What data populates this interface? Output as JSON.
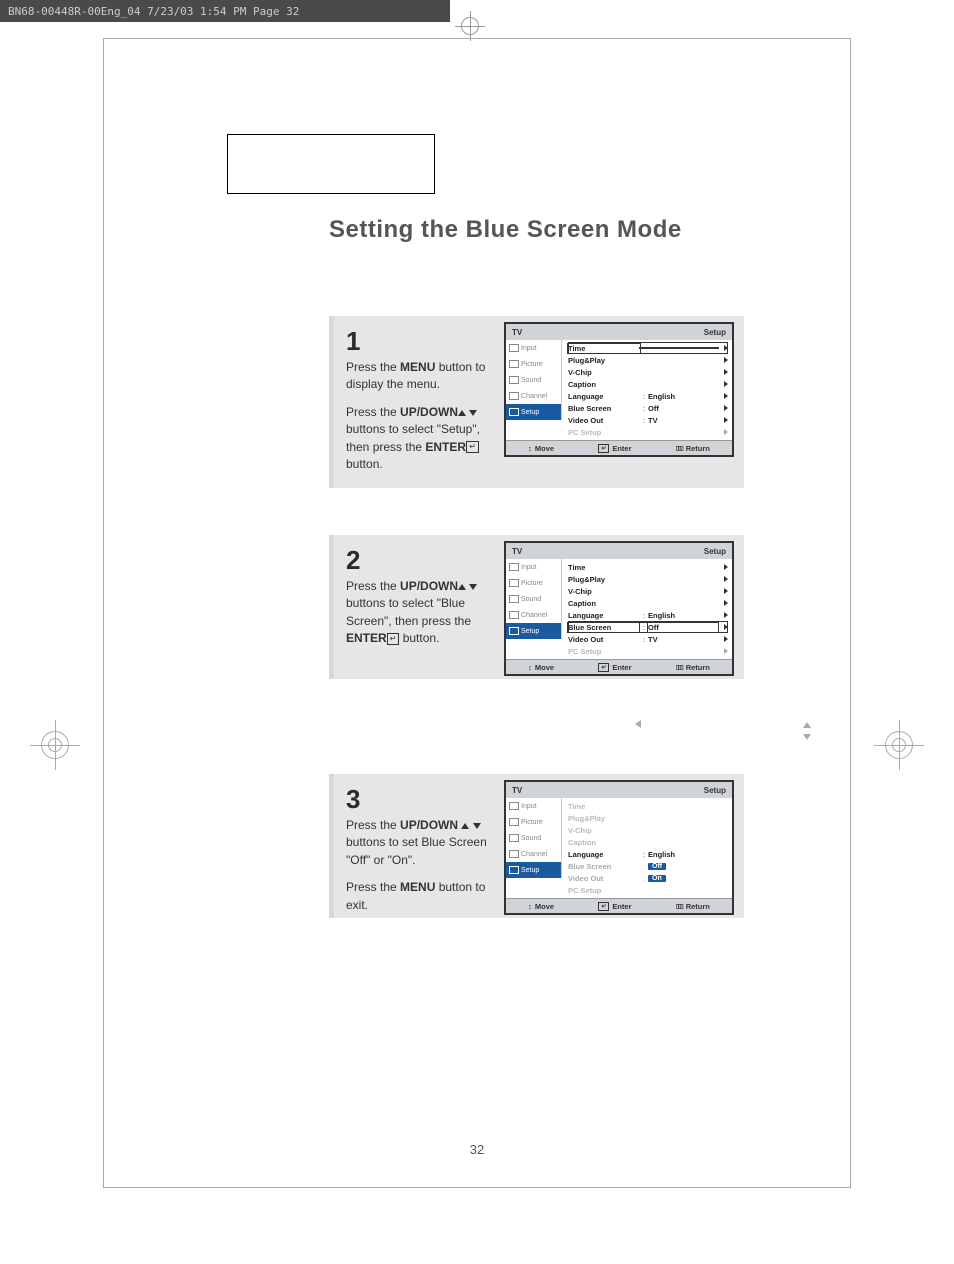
{
  "header_strip": "BN68-00448R-00Eng_04  7/23/03 1:54 PM  Page 32",
  "title": "Setting the Blue Screen Mode",
  "page_number": "32",
  "steps": {
    "1": {
      "num": "1",
      "para1_a": "Press the ",
      "para1_b": "MENU",
      "para1_c": " button to display the menu.",
      "para2_a": "Press the ",
      "para2_b": "UP/DOWN",
      "para2_c": " buttons to select \"Setup\", then press the ",
      "para2_d": "ENTER",
      "para2_e": " button."
    },
    "2": {
      "num": "2",
      "para1_a": "Press the ",
      "para1_b": "UP/DOWN",
      "para1_c": " buttons to select \"Blue Screen\", then press the ",
      "para1_d": "ENTER",
      "para1_e": "  button."
    },
    "3": {
      "num": "3",
      "para1_a": "Press the ",
      "para1_b": "UP/DOWN",
      "para1_c": " buttons to set Blue Screen \"Off\" or \"On\".",
      "para2_a": "Press the ",
      "para2_b": "MENU",
      "para2_c": " button to exit."
    }
  },
  "osd": {
    "tv_label": "TV",
    "section_label": "Setup",
    "sidebar": [
      "Input",
      "Picture",
      "Sound",
      "Channel",
      "Setup"
    ],
    "rows": {
      "time": "Time",
      "plugplay": "Plug&Play",
      "vchip": "V-Chip",
      "caption": "Caption",
      "language": "Language",
      "language_val": "English",
      "bluescreen": "Blue Screen",
      "bluescreen_val_off": "Off",
      "bluescreen_val_on": "On",
      "videoout": "Video Out",
      "videoout_val": "TV",
      "pcsetup": "PC Setup"
    },
    "footer": {
      "move": "Move",
      "enter": "Enter",
      "return": "Return"
    }
  }
}
